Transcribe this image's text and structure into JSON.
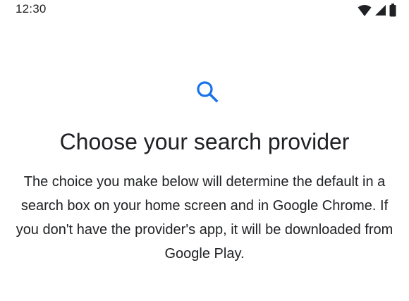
{
  "status_bar": {
    "time": "12:30",
    "icons": [
      "wifi-icon",
      "cellular-signal-icon",
      "battery-icon"
    ]
  },
  "header": {
    "icon": "search-icon",
    "title": "Choose your search provider",
    "description": "The choice you make below will determine the default in a search box on your home screen and in Google Chrome. If you don't have the provider's app, it will be downloaded from Google Play."
  },
  "colors": {
    "accent": "#1a73e8",
    "text": "#202124",
    "background": "#ffffff"
  }
}
